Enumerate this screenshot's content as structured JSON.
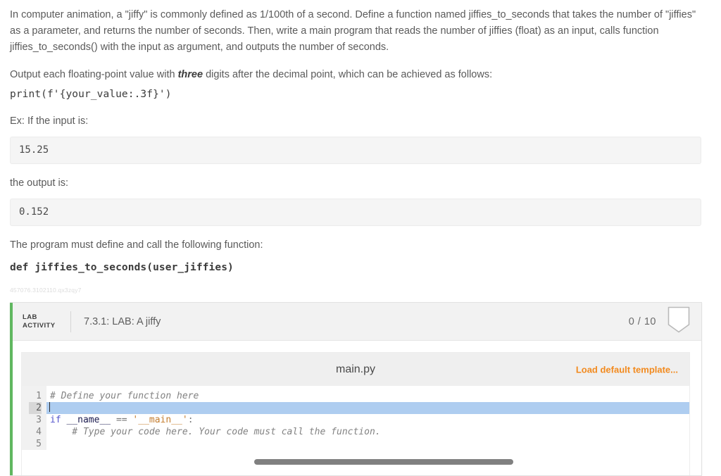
{
  "problem": {
    "paragraph1": "In computer animation, a \"jiffy\" is commonly defined as 1/100th of a second. Define a function named jiffies_to_seconds that takes the number of \"jiffies\" as a parameter, and returns the number of seconds. Then, write a main program that reads the number of jiffies (float) as an input, calls function jiffies_to_seconds() with the input as argument, and outputs the number of seconds.",
    "paragraph2_pre": "Output each floating-point value with ",
    "paragraph2_bold": "three",
    "paragraph2_post": " digits after the decimal point, which can be achieved as follows:",
    "print_snippet": "print(f'{your_value:.3f}')",
    "example_input_label": "Ex: If the input is:",
    "example_input_value": "15.25",
    "example_output_label": "the output is:",
    "example_output_value": "0.152",
    "function_requirement_label": "The program must define and call the following function:",
    "function_signature": "def jiffies_to_seconds(user_jiffies)",
    "watermark": "457076.3102110.qx3zqy7"
  },
  "lab": {
    "tag": "LAB\nACTIVITY",
    "title": "7.3.1: LAB: A jiffy",
    "score": "0 / 10",
    "badge_icon": "shield-badge-icon",
    "accent_color": "#60b760"
  },
  "editor": {
    "filename": "main.py",
    "load_template_label": "Load default template...",
    "load_template_color": "#f28a1e",
    "gutter_numbers": [
      "1",
      "2",
      "3",
      "4",
      "5"
    ],
    "active_line": 2,
    "lines": [
      {
        "n": "1",
        "tokens": [
          {
            "t": "# Define your function here",
            "c": "tok-comment"
          }
        ]
      },
      {
        "n": "2",
        "tokens": []
      },
      {
        "n": "3",
        "tokens": [
          {
            "t": "if",
            "c": "tok-kw"
          },
          {
            "t": " ",
            "c": "tok-plain"
          },
          {
            "t": "__name__",
            "c": "tok-name"
          },
          {
            "t": " ",
            "c": "tok-plain"
          },
          {
            "t": "==",
            "c": "tok-op"
          },
          {
            "t": " ",
            "c": "tok-plain"
          },
          {
            "t": "'__main__'",
            "c": "tok-str"
          },
          {
            "t": ":",
            "c": "tok-op"
          }
        ]
      },
      {
        "n": "4",
        "tokens": [
          {
            "t": "    # Type your code here. Your code must call the function.",
            "c": "tok-comment"
          }
        ]
      },
      {
        "n": "5",
        "tokens": []
      }
    ],
    "scrollbar": {
      "name": "horizontal-scrollbar"
    }
  }
}
